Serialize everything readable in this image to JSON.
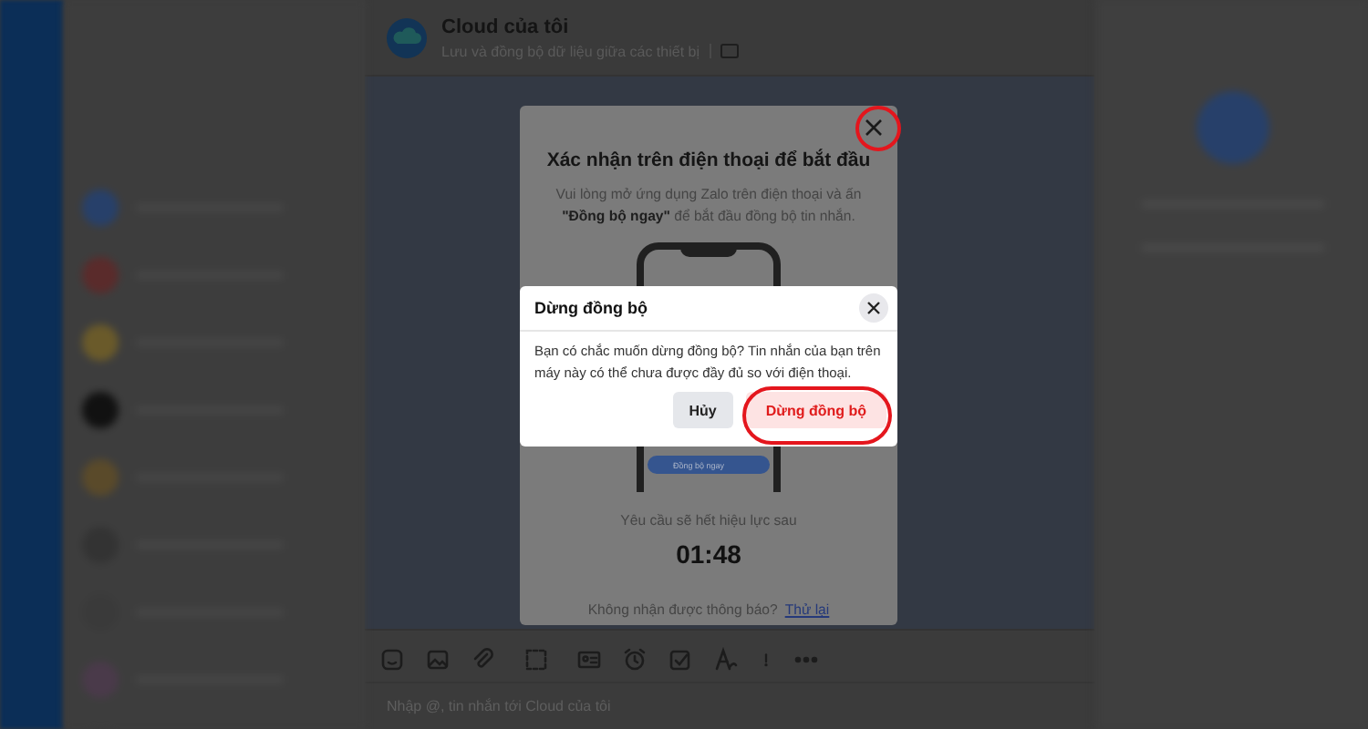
{
  "chat_header": {
    "title": "Cloud của tôi",
    "subtitle": "Lưu và đồng bộ dữ liệu giữa các thiết bị"
  },
  "composer": {
    "placeholder": "Nhập @, tin nhắn tới Cloud của tôi"
  },
  "sync_modal": {
    "title": "Xác nhận trên điện thoại để bắt đầu",
    "description": "Vui lòng mở ứng dụng Zalo trên điện thoại và ấn **\"Đồng bộ ngay\"** để bắt đầu đồng bộ tin nhắn.",
    "phone_button": "Đồng bộ ngay",
    "expiry_label": "Yêu cầu sẽ hết hiệu lực sau",
    "countdown": "01:48",
    "retry_prompt": "Không nhận được thông báo?",
    "retry_link": "Thử lại"
  },
  "confirm_dialog": {
    "title": "Dừng đồng bộ",
    "message": "Bạn có chắc muốn dừng đồng bộ? Tin nhắn của bạn trên máy này có thể chưa được đầy đủ so với điện thoại.",
    "buttons": [
      {
        "label": "Hủy",
        "kind": "secondary"
      },
      {
        "label": "Dừng đồng bộ",
        "kind": "danger"
      }
    ]
  }
}
